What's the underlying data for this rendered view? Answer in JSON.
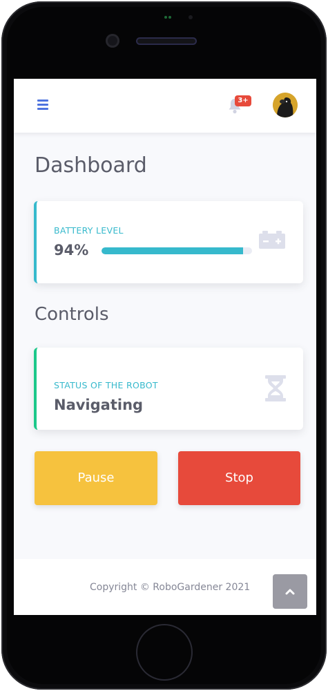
{
  "header": {
    "notification_badge": "3+"
  },
  "page": {
    "title": "Dashboard"
  },
  "battery_card": {
    "label": "BATTERY LEVEL",
    "value": "94%",
    "progress_percent": 94,
    "accent_color": "#36b9cc",
    "icon": "battery-icon"
  },
  "controls": {
    "section_title": "Controls"
  },
  "status_card": {
    "label": "STATUS OF THE ROBOT",
    "value": "Navigating",
    "accent_color": "#1cc88a",
    "icon": "hourglass-icon"
  },
  "actions": {
    "pause_label": "Pause",
    "stop_label": "Stop",
    "pause_color": "#f6c23e",
    "stop_color": "#e74a3b"
  },
  "footer": {
    "copyright": "Copyright © RoboGardener 2021"
  }
}
